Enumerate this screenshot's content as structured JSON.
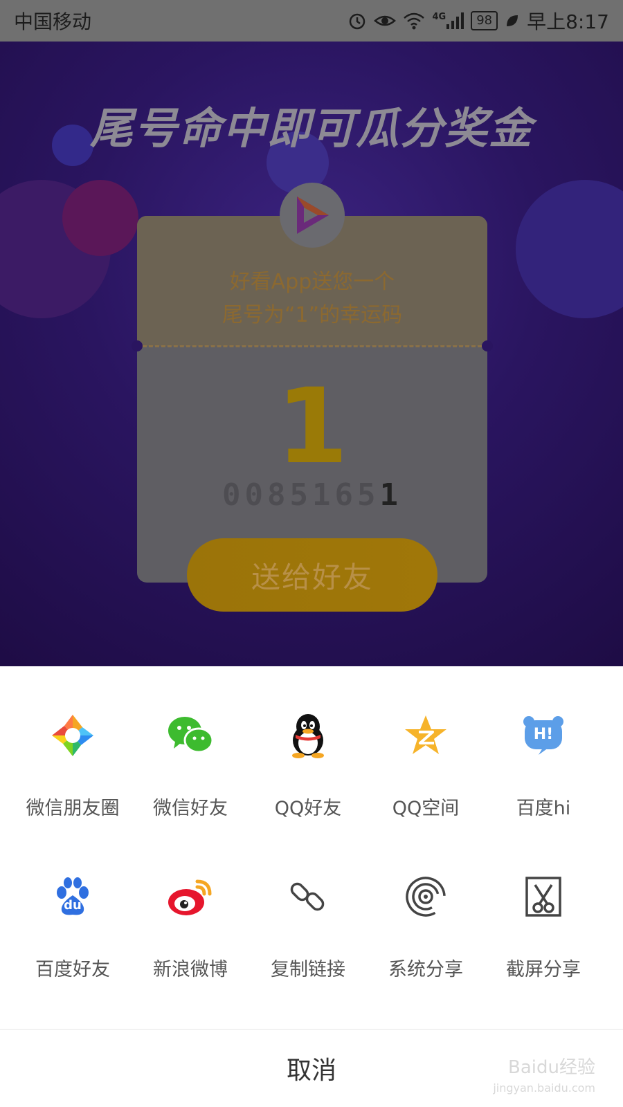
{
  "status_bar": {
    "carrier": "中国移动",
    "network": "4G",
    "battery": "98",
    "time": "早上8:17"
  },
  "promo": {
    "title": "尾号命中即可瓜分奖金",
    "card_line1": "好看App送您一个",
    "card_line2": "尾号为“1”的幸运码",
    "big_digit": "1",
    "code_prefix": "0085165",
    "code_last": "1",
    "send_button": "送给好友"
  },
  "share": {
    "items": [
      {
        "label": "微信朋友圈",
        "icon": "wechat-moments-icon"
      },
      {
        "label": "微信好友",
        "icon": "wechat-icon"
      },
      {
        "label": "QQ好友",
        "icon": "qq-icon"
      },
      {
        "label": "QQ空间",
        "icon": "qzone-icon"
      },
      {
        "label": "百度hi",
        "icon": "baidu-hi-icon"
      },
      {
        "label": "百度好友",
        "icon": "baidu-paw-icon"
      },
      {
        "label": "新浪微博",
        "icon": "weibo-icon"
      },
      {
        "label": "复制链接",
        "icon": "link-icon"
      },
      {
        "label": "系统分享",
        "icon": "system-share-icon"
      },
      {
        "label": "截屏分享",
        "icon": "screenshot-scissors-icon"
      }
    ],
    "baidu_hi_badge": "H!",
    "baidu_paw_text": "du",
    "cancel": "取消"
  },
  "watermark": {
    "line1": "Baidu经验",
    "line2": "jingyan.baidu.com"
  },
  "colors": {
    "overlay_gray": "#707070",
    "accent_gold": "#9b7409",
    "background_purple": "#2a1560"
  }
}
